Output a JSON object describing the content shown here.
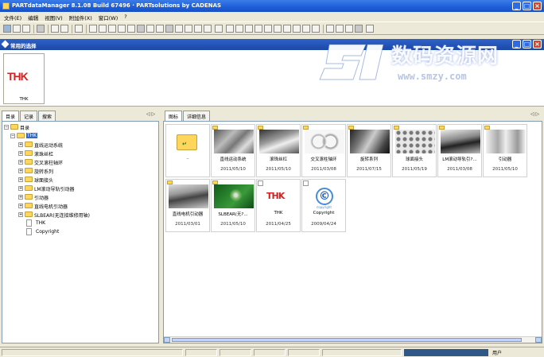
{
  "window": {
    "title": "PARTdataManager 8.1.08 Build 67496 · PARTsolutions by CADENAS",
    "minimize": "_",
    "maximize": "□",
    "close": "×"
  },
  "menu": [
    "文件(E)",
    "编辑",
    "视图(V)",
    "附加件(X)",
    "窗口(W)",
    "?"
  ],
  "secondary_bar": {
    "title": "常用的选择",
    "minimize": "_",
    "maximize": "□",
    "close": "×"
  },
  "watermark": {
    "main": "数码资源网",
    "sub": "www.smzy.com"
  },
  "recent": {
    "logo": "THK",
    "label": "THK"
  },
  "left_tabs": [
    "目录",
    "记录",
    "搜索"
  ],
  "left_nav": "◁ ▷",
  "tree": [
    {
      "label": "目录",
      "level": 0,
      "type": "folder",
      "expanded": true
    },
    {
      "label": "THK",
      "level": 1,
      "type": "folder",
      "expanded": true,
      "selected": true
    },
    {
      "label": "直线运动系统",
      "level": 2,
      "type": "folder"
    },
    {
      "label": "滚珠丝杠",
      "level": 2,
      "type": "folder"
    },
    {
      "label": "交叉滚柱轴环",
      "level": 2,
      "type": "folder"
    },
    {
      "label": "旋转系列",
      "level": 2,
      "type": "folder"
    },
    {
      "label": "球面接头",
      "level": 2,
      "type": "folder"
    },
    {
      "label": "LM滚动导轨引动器",
      "level": 2,
      "type": "folder"
    },
    {
      "label": "引动器",
      "level": 2,
      "type": "folder"
    },
    {
      "label": "直线电机引动器",
      "level": 2,
      "type": "folder"
    },
    {
      "label": "SLBEAR(无连接维修用轴)",
      "level": 2,
      "type": "folder"
    },
    {
      "label": "THK",
      "level": 2,
      "type": "doc"
    },
    {
      "label": "Copyright",
      "level": 2,
      "type": "doc"
    }
  ],
  "right_tabs": [
    "图标",
    "详细信息"
  ],
  "right_nav": "◁ ▷",
  "items": [
    {
      "name": "..",
      "date": "",
      "kind": "folder-up"
    },
    {
      "name": "直线运动系统",
      "date": "2011/05/10",
      "kind": "metal"
    },
    {
      "name": "滚珠丝杠",
      "date": "2011/05/10",
      "kind": "metal2"
    },
    {
      "name": "交叉滚柱轴环",
      "date": "2011/03/08",
      "kind": "ring"
    },
    {
      "name": "旋转系列",
      "date": "2011/07/15",
      "kind": "dark"
    },
    {
      "name": "球面接头",
      "date": "2011/05/19",
      "kind": "balls"
    },
    {
      "name": "LM滚动导轨引?...",
      "date": "2011/03/08",
      "kind": "rail"
    },
    {
      "name": "引动器",
      "date": "2011/05/10",
      "kind": "rail2"
    },
    {
      "name": "直线电机引动器",
      "date": "2011/03/01",
      "kind": "long"
    },
    {
      "name": "SLBEAR(无?...",
      "date": "2011/05/10",
      "kind": "green"
    },
    {
      "name": "THK",
      "date": "2011/04/25",
      "kind": "thk"
    },
    {
      "name": "Copyright",
      "date": "2009/04/24",
      "kind": "copyright"
    }
  ],
  "copyright_icon": {
    "symbol": "©",
    "caption": "copyright"
  },
  "thk_thumb_logo": "THK",
  "status": {
    "right_text": "用户"
  },
  "colors": {
    "title_bar": "#1d5ed8",
    "thk_red": "#d42020",
    "selection": "#316ac5"
  }
}
